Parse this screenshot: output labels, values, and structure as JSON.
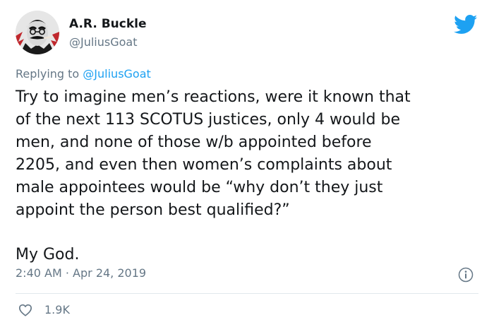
{
  "author": {
    "name": "A.R. Buckle",
    "handle": "@JuliusGoat"
  },
  "reply": {
    "prefix": "Replying to",
    "mention": "@JuliusGoat"
  },
  "body_lines": [
    "Try to imagine men’s reactions, were it known that",
    "of the next 113 SCOTUS justices, only 4 would be",
    "men, and none of those w/b appointed before",
    "2205, and even then women’s complaints about",
    "male appointees would be “why don’t they just",
    "appoint the person best qualified?”"
  ],
  "closing_line": "My God.",
  "timestamp": {
    "time": "2:40 AM",
    "separator": "·",
    "date": "Apr 24, 2019"
  },
  "likes": {
    "count": "1.9K"
  },
  "icons": {
    "brand": "twitter-bird-icon",
    "info": "info-icon",
    "like": "heart-icon"
  },
  "colors": {
    "brand_blue": "#1da1f2",
    "secondary_text": "#657786",
    "primary_text": "#14171a",
    "divider": "#e1e8ed"
  }
}
